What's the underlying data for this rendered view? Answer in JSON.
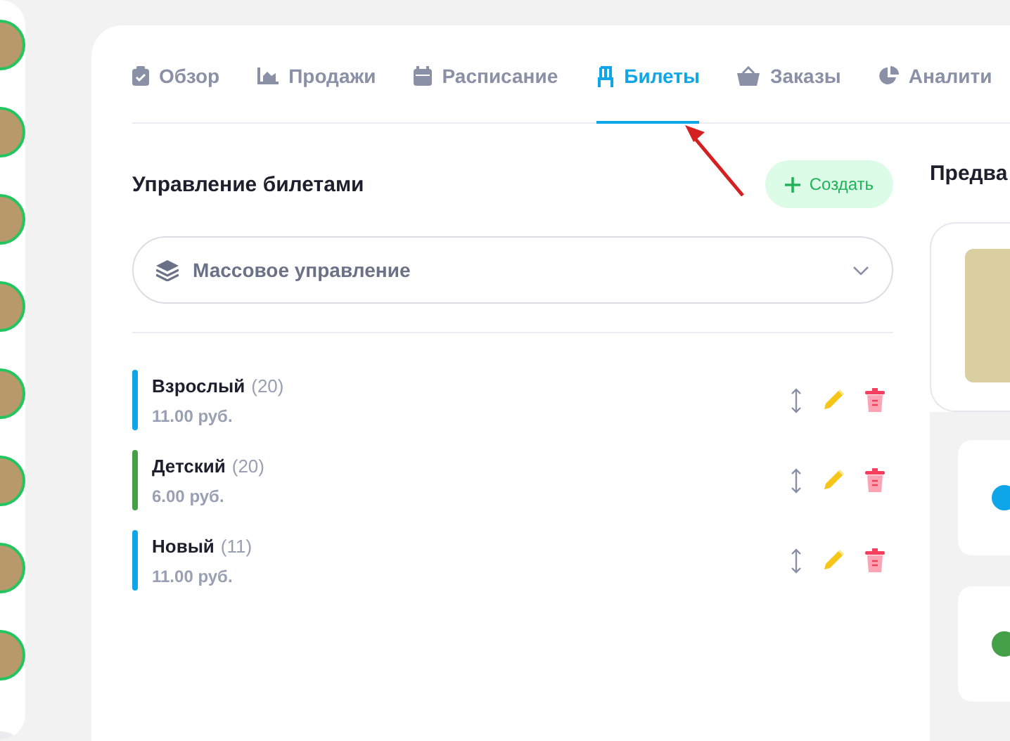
{
  "sidebar": {
    "avatars": [
      {
        "kind": "photo"
      },
      {
        "kind": "photo"
      },
      {
        "kind": "photo"
      },
      {
        "kind": "photo"
      },
      {
        "kind": "photo"
      },
      {
        "kind": "photo"
      },
      {
        "kind": "photo"
      },
      {
        "kind": "photo"
      },
      {
        "kind": "blank"
      }
    ]
  },
  "tabs": [
    {
      "label": "Обзор",
      "kind": "clipboard",
      "selected": false
    },
    {
      "label": "Продажи",
      "kind": "chart",
      "selected": false
    },
    {
      "label": "Расписание",
      "kind": "calendar",
      "selected": false
    },
    {
      "label": "Билеты",
      "kind": "chair",
      "selected": true
    },
    {
      "label": "Заказы",
      "kind": "basket",
      "selected": false
    },
    {
      "label": "Аналити",
      "kind": "pie",
      "selected": false
    }
  ],
  "tickets": {
    "title": "Управление билетами",
    "create_button": "Создать",
    "bulk_select": {
      "value": "Массовое управление"
    },
    "items": [
      {
        "name": "Взрослый",
        "count": "(20)",
        "price": "11.00 руб.",
        "color": "#0ea5e9"
      },
      {
        "name": "Детский",
        "count": "(20)",
        "price": "6.00 руб.",
        "color": "#43a047"
      },
      {
        "name": "Новый",
        "count": "(11)",
        "price": "11.00 руб.",
        "color": "#0ea5e9"
      }
    ]
  },
  "preview": {
    "title": "Предва",
    "items": [
      {
        "color": "#0ea5e9"
      },
      {
        "color": "#43a047"
      }
    ]
  }
}
